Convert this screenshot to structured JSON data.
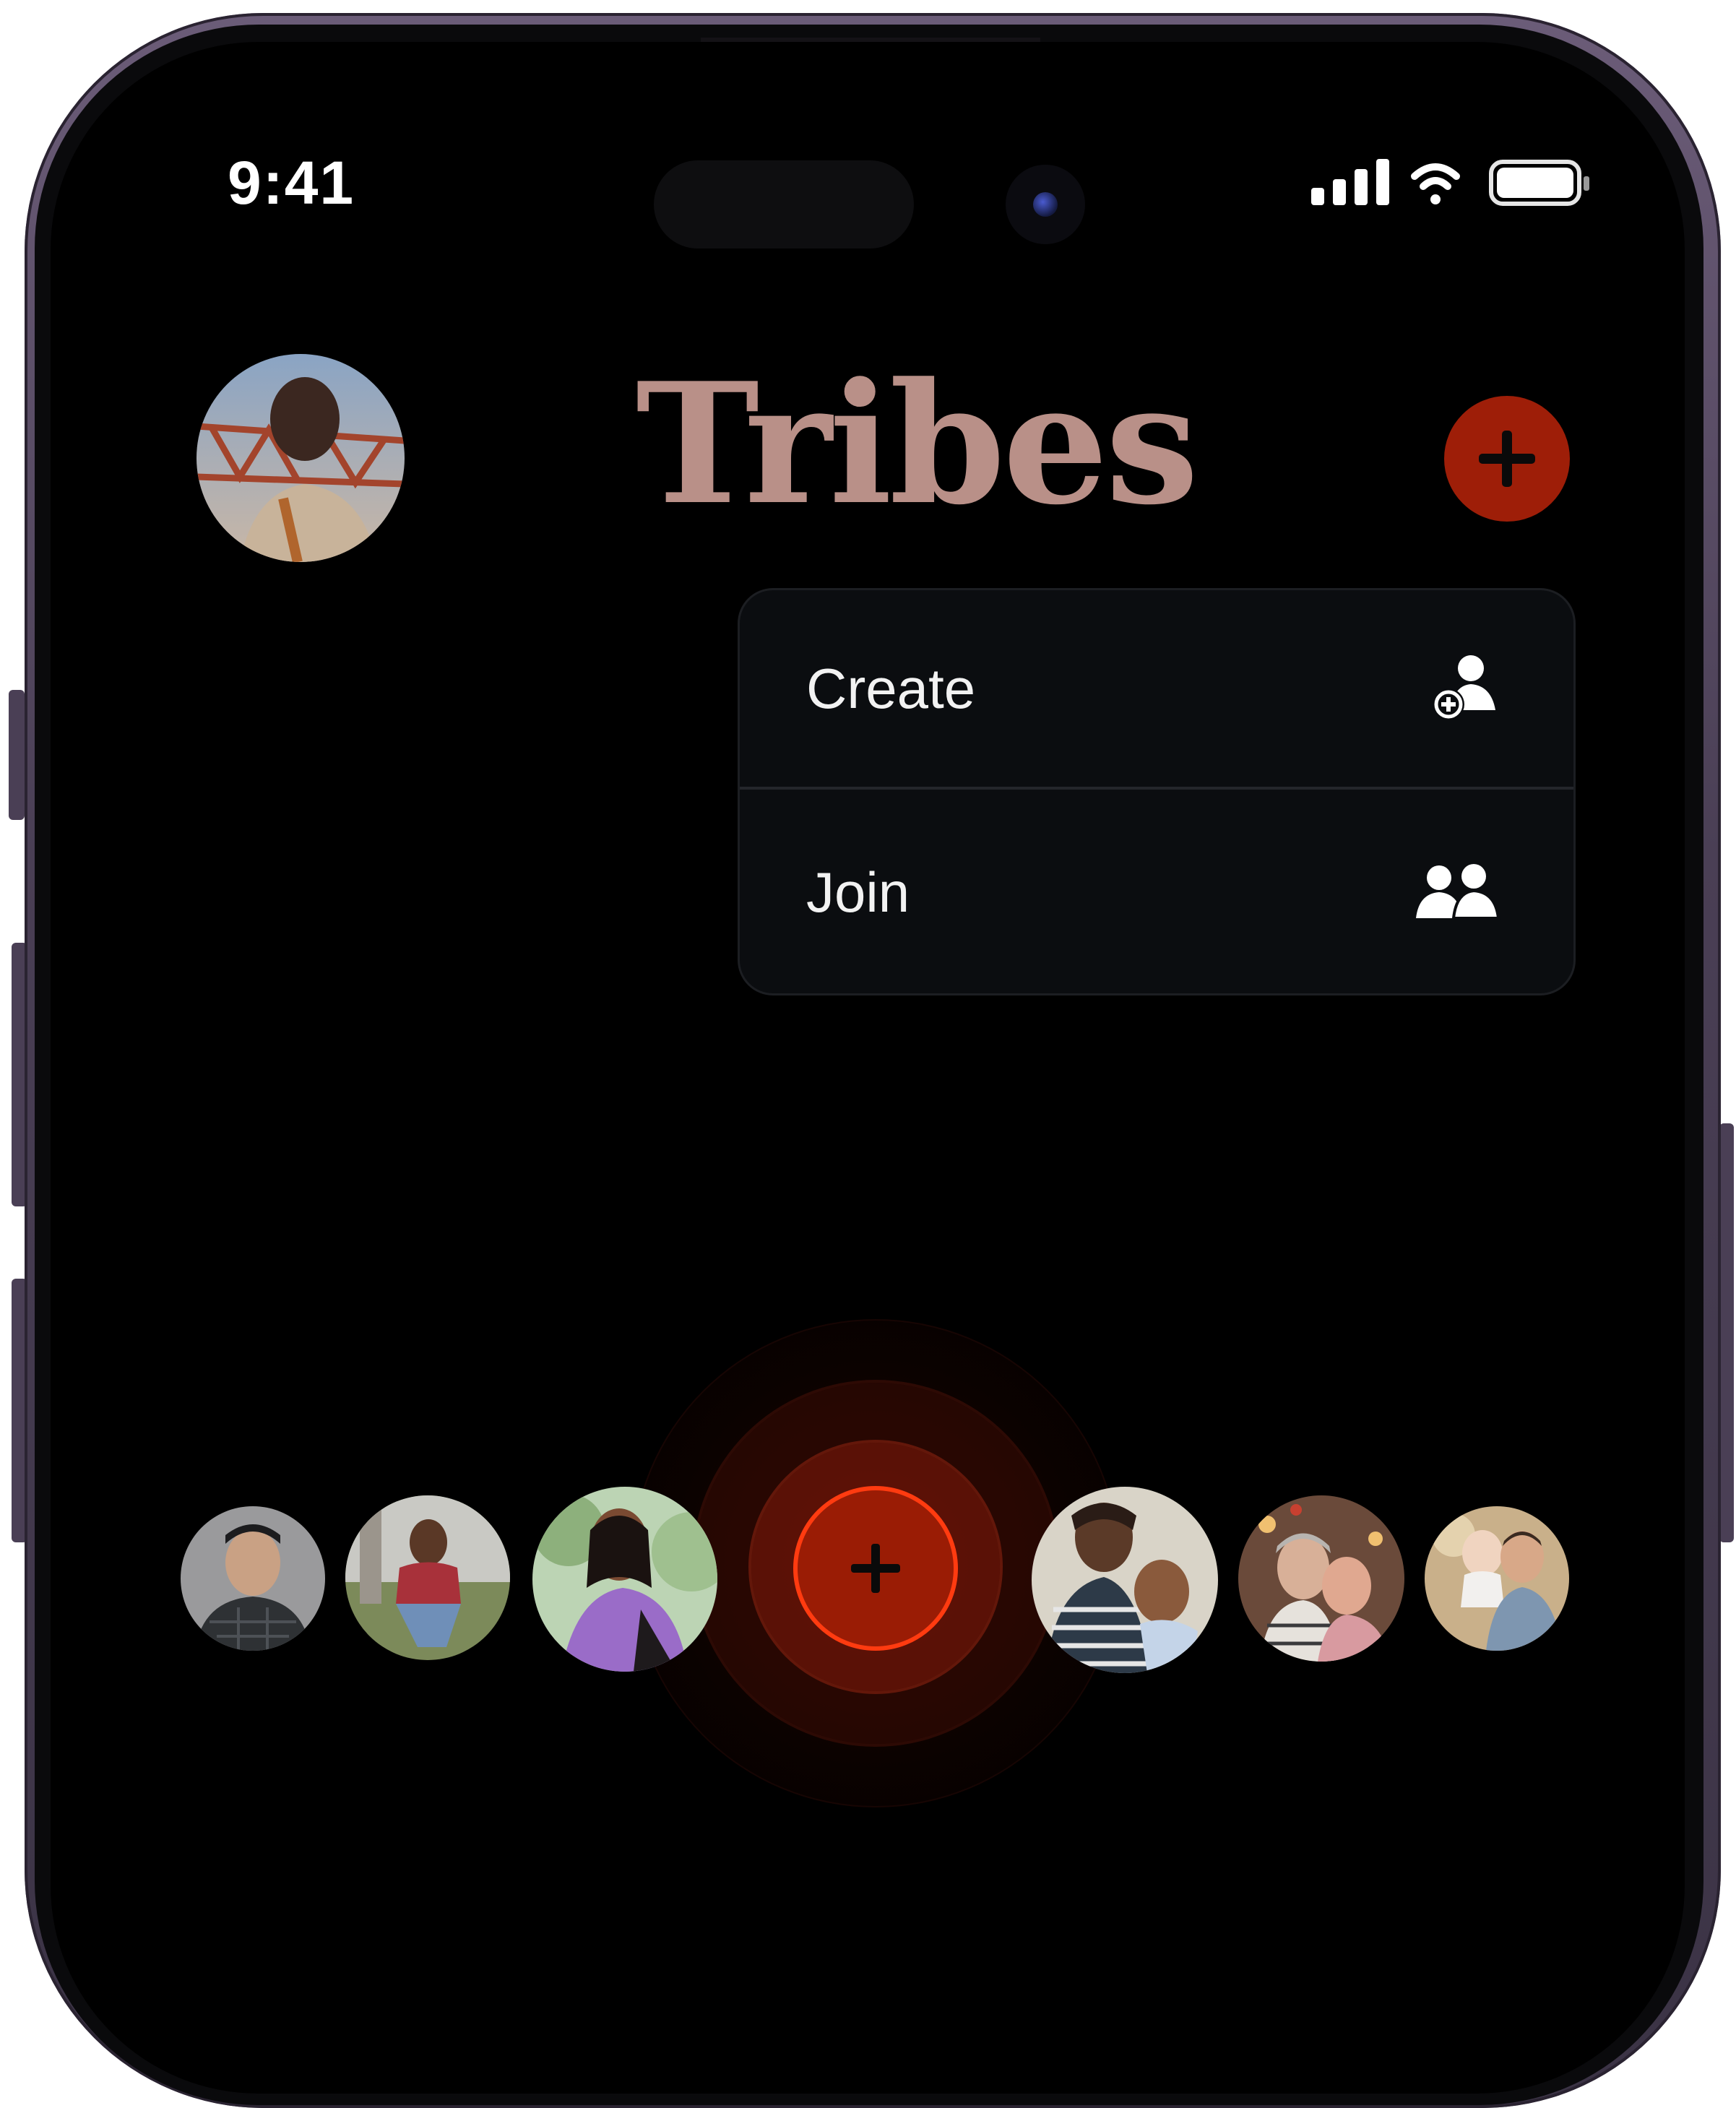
{
  "status_bar": {
    "time": "9:41"
  },
  "header": {
    "title": "Tribes"
  },
  "menu": {
    "items": [
      {
        "label": "Create",
        "icon": "person-add-icon"
      },
      {
        "label": "Join",
        "icon": "people-icon"
      }
    ]
  },
  "colors": {
    "title": "#b99088",
    "accent": "#9e1e08",
    "accent_bright": "#ff3b10",
    "background": "#000000",
    "menu_background": "#0b0d10"
  }
}
